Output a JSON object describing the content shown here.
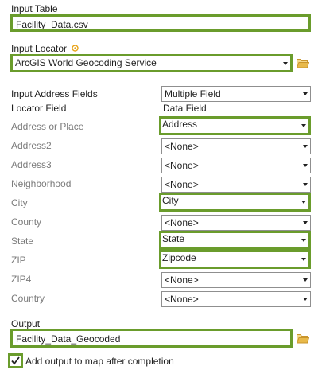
{
  "input_table": {
    "label": "Input Table",
    "value": "Facility_Data.csv"
  },
  "input_locator": {
    "label": "Input Locator",
    "value": "ArcGIS World Geocoding Service",
    "indicator_color": "#e8a317"
  },
  "address_fields": {
    "label": "Input Address Fields",
    "value": "Multiple Field"
  },
  "columns": {
    "locator_field": "Locator Field",
    "data_field": "Data Field"
  },
  "field_rows": [
    {
      "field": "Address or Place",
      "value": "Address"
    },
    {
      "field": "Address2",
      "value": "<None>"
    },
    {
      "field": "Address3",
      "value": "<None>"
    },
    {
      "field": "Neighborhood",
      "value": "<None>"
    },
    {
      "field": "City",
      "value": "City"
    },
    {
      "field": "County",
      "value": "<None>"
    },
    {
      "field": "State",
      "value": "State"
    },
    {
      "field": "ZIP",
      "value": "Zipcode"
    },
    {
      "field": "ZIP4",
      "value": "<None>"
    },
    {
      "field": "Country",
      "value": "<None>"
    }
  ],
  "output": {
    "label": "Output",
    "value": "Facility_Data_Geocoded"
  },
  "add_to_map": {
    "label": "Add output to map after completion",
    "checked": true
  },
  "colors": {
    "highlight": "#6a9c2c",
    "folder": "#e8b94a",
    "label_gray": "#7a7a7a"
  },
  "icons": [
    "folder-icon",
    "chevron-down-icon",
    "checkmark-icon",
    "required-indicator-icon"
  ]
}
